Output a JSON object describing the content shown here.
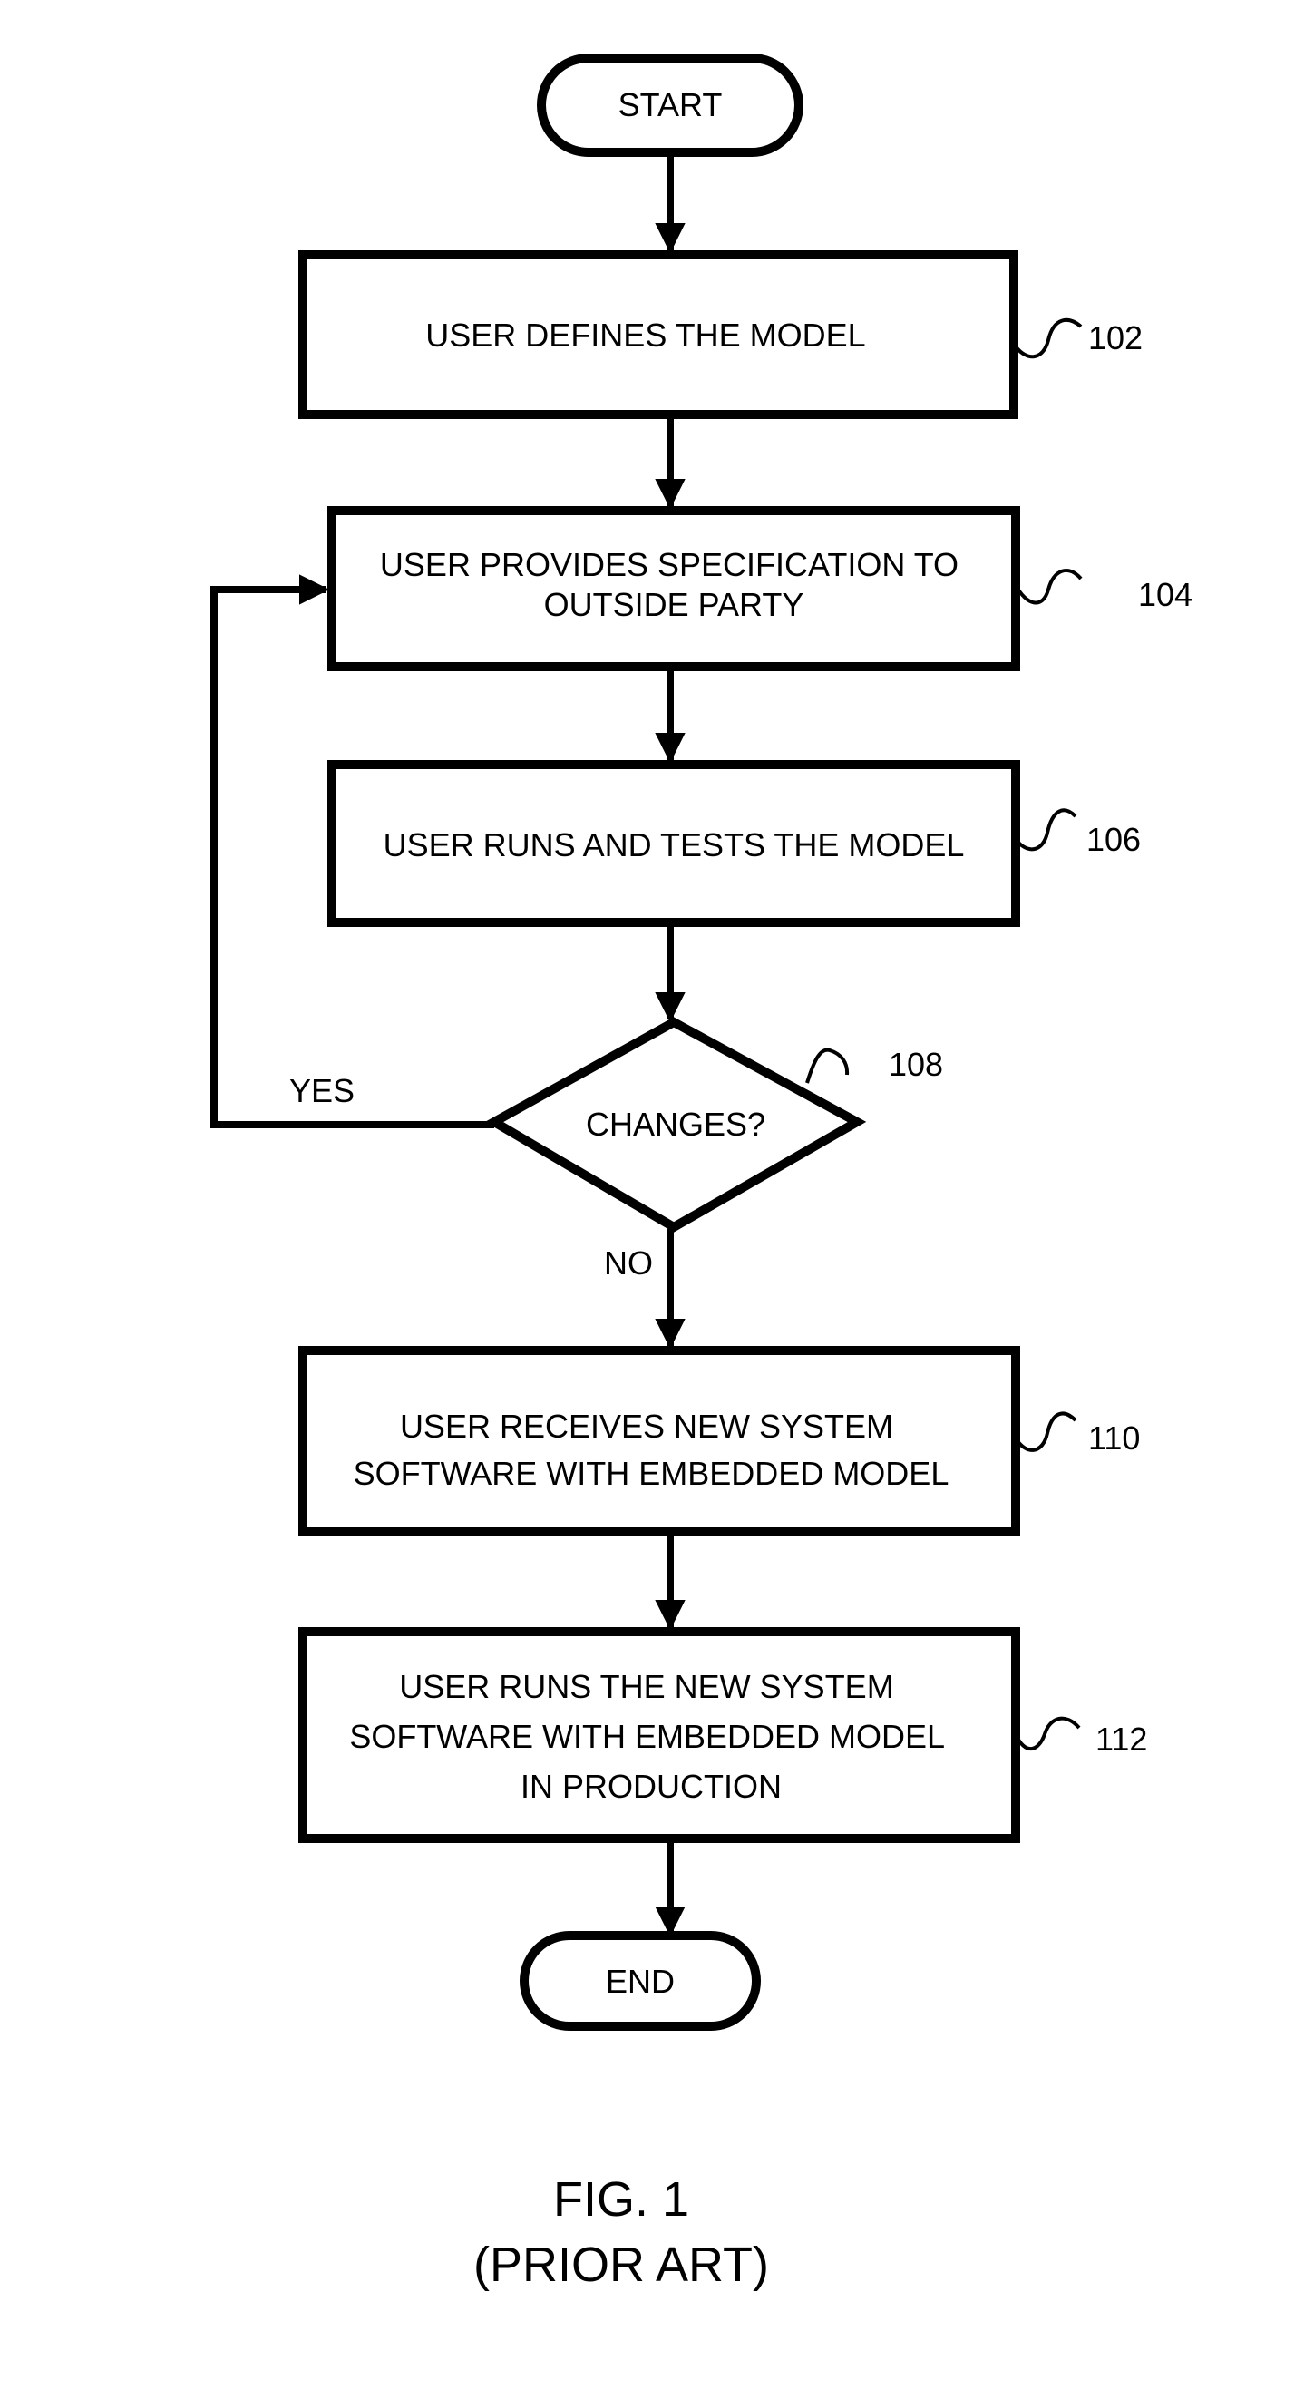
{
  "diagram": {
    "start": {
      "label": "START"
    },
    "end": {
      "label": "END"
    },
    "steps": [
      {
        "id": "102",
        "lines": [
          "USER DEFINES THE MODEL"
        ]
      },
      {
        "id": "104",
        "lines": [
          "USER PROVIDES SPECIFICATION TO",
          "OUTSIDE PARTY"
        ]
      },
      {
        "id": "106",
        "lines": [
          "USER RUNS AND TESTS THE MODEL"
        ]
      },
      {
        "id": "110",
        "lines": [
          "USER RECEIVES NEW SYSTEM",
          "SOFTWARE WITH EMBEDDED MODEL"
        ]
      },
      {
        "id": "112",
        "lines": [
          "USER RUNS THE NEW SYSTEM",
          "SOFTWARE WITH EMBEDDED MODEL",
          "IN PRODUCTION"
        ]
      }
    ],
    "decision": {
      "id": "108",
      "label": "CHANGES?",
      "yes_label": "YES",
      "no_label": "NO"
    },
    "caption": {
      "figure": "FIG. 1",
      "note": "(PRIOR ART)"
    }
  }
}
